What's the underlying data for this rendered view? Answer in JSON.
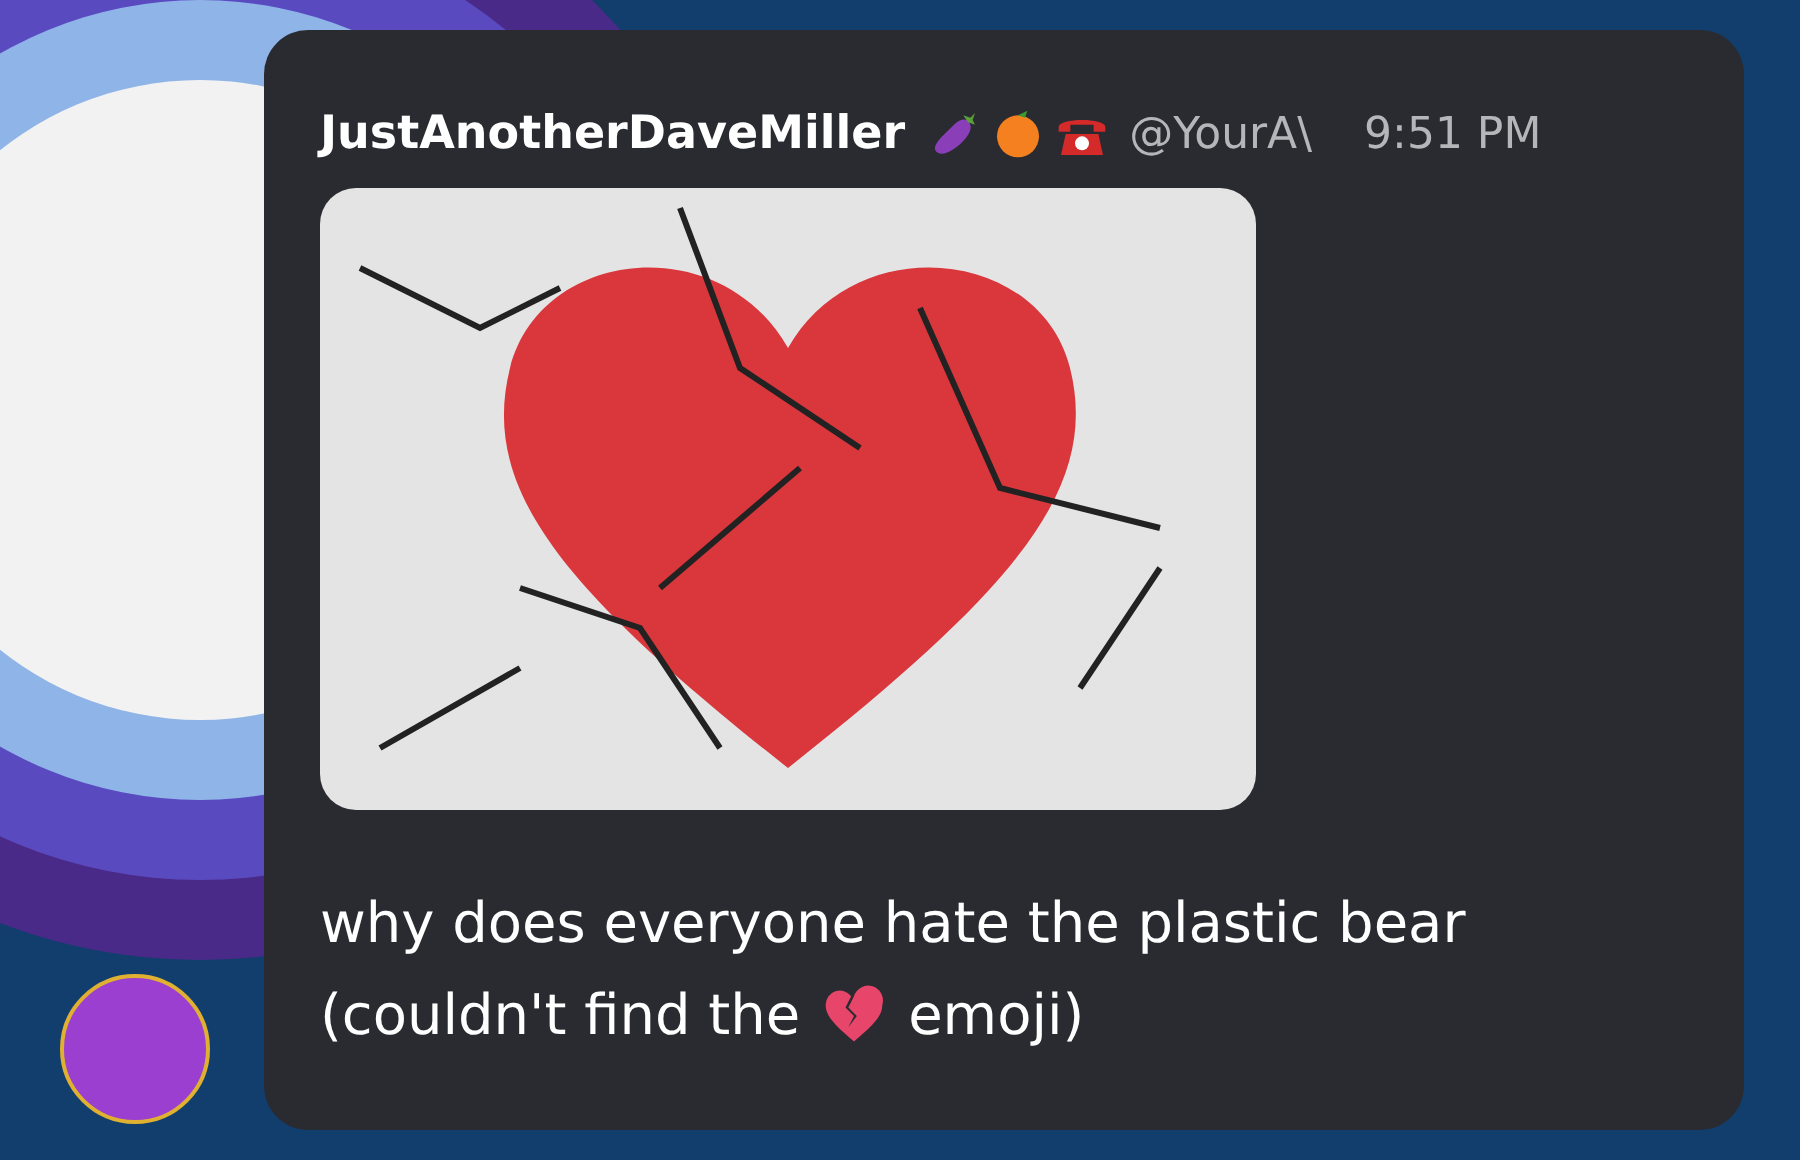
{
  "message": {
    "author": "JustAnotherDaveMiller",
    "handle": "@YourA\\",
    "time": "9:51 PM",
    "lines": [
      {
        "kind": "text",
        "text": "why does everyone hate the plastic bear"
      },
      {
        "kind": "emoji_inline",
        "before": "(couldn't find the",
        "after": "emoji)"
      }
    ]
  }
}
